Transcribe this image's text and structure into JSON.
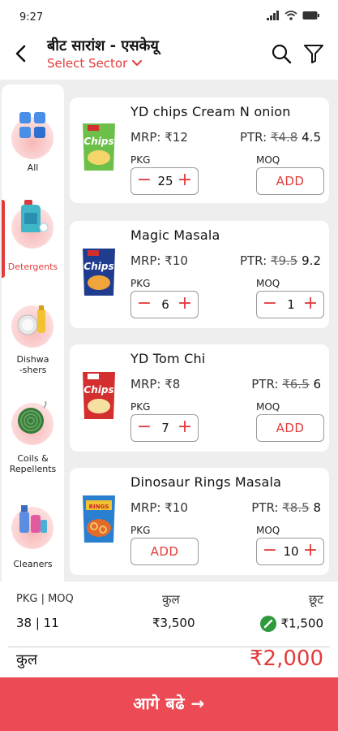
{
  "status": {
    "time": "9:27"
  },
  "header": {
    "title": "बीट सारांश - एसकेयू",
    "sector_label": "Select Sector"
  },
  "categories": [
    {
      "label": "All",
      "icon": "all-grid-icon"
    },
    {
      "label": "Detergents",
      "icon": "detergent-icon",
      "active": true
    },
    {
      "label": "Dishwa\n-shers",
      "icon": "dishwasher-icon"
    },
    {
      "label": "Coils &\nRepellents",
      "icon": "mosquito-coil-icon"
    },
    {
      "label": "Cleaners",
      "icon": "cleaner-icon"
    }
  ],
  "labels": {
    "pkg": "PKG",
    "moq": "MOQ",
    "add": "ADD",
    "minus": "−",
    "plus": "+"
  },
  "products": [
    {
      "name": "YD chips Cream N onion",
      "mrp": "MRP: ₹12",
      "ptr_label": "PTR:",
      "ptr_old": "₹4.8",
      "ptr_new": "4.5",
      "pkg_qty": "25",
      "moq_qty": "",
      "image": "chips-green-pack"
    },
    {
      "name": "Magic Masala",
      "mrp": "MRP: ₹10",
      "ptr_label": "PTR:",
      "ptr_old": "₹9.5",
      "ptr_new": "9.2",
      "pkg_qty": "6",
      "moq_qty": "1",
      "image": "chips-blue-pack"
    },
    {
      "name": "YD Tom Chi",
      "mrp": "MRP: ₹8",
      "ptr_label": "PTR:",
      "ptr_old": "₹6.5",
      "ptr_new": "6",
      "pkg_qty": "7",
      "moq_qty": "",
      "image": "chips-red-pack"
    },
    {
      "name": "Dinosaur Rings Masala",
      "mrp": "MRP: ₹10",
      "ptr_label": "PTR:",
      "ptr_old": "₹8.5",
      "ptr_new": "8",
      "pkg_qty": "",
      "moq_qty": "10",
      "image": "rings-pack"
    }
  ],
  "summary": {
    "pkg_moq_label": "PKG | MOQ",
    "pkg_moq_value": "38 | 11",
    "total_label": "कुल",
    "total_value": "₹3,500",
    "discount_label": "छूट",
    "discount_value": "₹1,500",
    "grand_label": "कुल",
    "grand_value": "₹2,000"
  },
  "cta": {
    "label": "आगे बढे →"
  },
  "colors": {
    "accent": "#e23b3b",
    "cta": "#ec4a55",
    "discount": "#2e9a3e"
  }
}
